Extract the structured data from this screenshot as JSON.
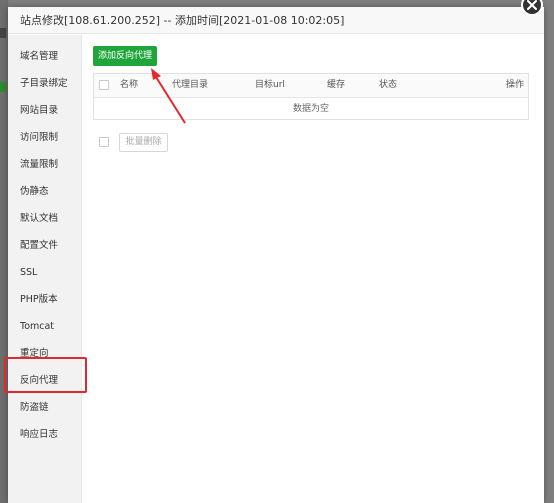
{
  "dialog": {
    "title": "站点修改[108.61.200.252] -- 添加时间[2021-01-08 10:02:05]"
  },
  "sidebar": {
    "items": [
      {
        "label": "域名管理"
      },
      {
        "label": "子目录绑定"
      },
      {
        "label": "网站目录"
      },
      {
        "label": "访问限制"
      },
      {
        "label": "流量限制"
      },
      {
        "label": "伪静态"
      },
      {
        "label": "默认文档"
      },
      {
        "label": "配置文件"
      },
      {
        "label": "SSL"
      },
      {
        "label": "PHP版本"
      },
      {
        "label": "Tomcat"
      },
      {
        "label": "重定向"
      },
      {
        "label": "反向代理"
      },
      {
        "label": "防盗链"
      },
      {
        "label": "响应日志"
      }
    ],
    "active_item": "反向代理"
  },
  "main": {
    "add_button": "添加反向代理",
    "table": {
      "columns": [
        "名称",
        "代理目录",
        "目标url",
        "缓存",
        "状态",
        "操作"
      ],
      "empty_text": "数据为空"
    },
    "batch_delete_button": "批量删除"
  },
  "colors": {
    "primary_green": "#20a53a",
    "annotation_red": "#e0282e",
    "overlay_gray": "#7f7f7f"
  },
  "icons": {
    "close": "close-icon",
    "annotation_arrow": "arrow-icon"
  }
}
